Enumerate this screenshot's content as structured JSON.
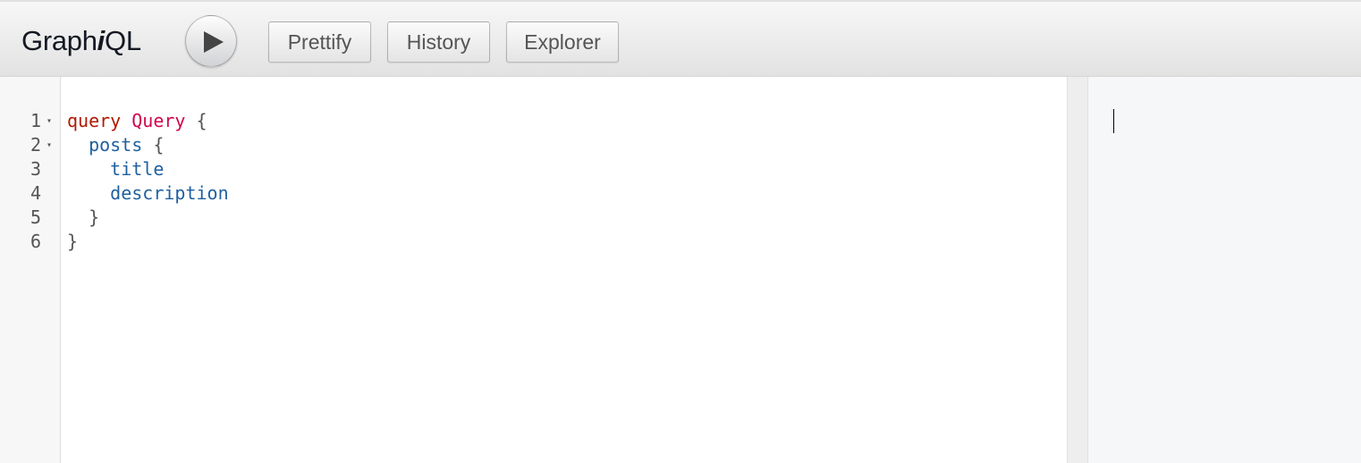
{
  "toolbar": {
    "title_prefix": "Graph",
    "title_italic": "i",
    "title_suffix": "QL",
    "run_icon": "play-icon",
    "prettify_label": "Prettify",
    "history_label": "History",
    "explorer_label": "Explorer"
  },
  "colors": {
    "keyword": "#B11A04",
    "def": "#D2054E",
    "property": "#1F61A0",
    "punctuation": "#555555"
  },
  "editor": {
    "lines": [
      {
        "num": "1",
        "fold": "▾",
        "indent": "",
        "tokens": [
          {
            "t": "query",
            "c": "kw"
          },
          {
            "t": " ",
            "c": "punc"
          },
          {
            "t": "Query",
            "c": "def"
          },
          {
            "t": " {",
            "c": "punc"
          }
        ]
      },
      {
        "num": "2",
        "fold": "▾",
        "indent": "  ",
        "tokens": [
          {
            "t": "posts",
            "c": "prop"
          },
          {
            "t": " {",
            "c": "punc"
          }
        ]
      },
      {
        "num": "3",
        "fold": "",
        "indent": "    ",
        "tokens": [
          {
            "t": "title",
            "c": "prop"
          }
        ]
      },
      {
        "num": "4",
        "fold": "",
        "indent": "    ",
        "tokens": [
          {
            "t": "description",
            "c": "prop"
          }
        ]
      },
      {
        "num": "5",
        "fold": "",
        "indent": "  ",
        "tokens": [
          {
            "t": "}",
            "c": "punc"
          }
        ]
      },
      {
        "num": "6",
        "fold": "",
        "indent": "",
        "tokens": [
          {
            "t": "}",
            "c": "punc"
          }
        ]
      }
    ]
  },
  "result": {
    "content": ""
  }
}
